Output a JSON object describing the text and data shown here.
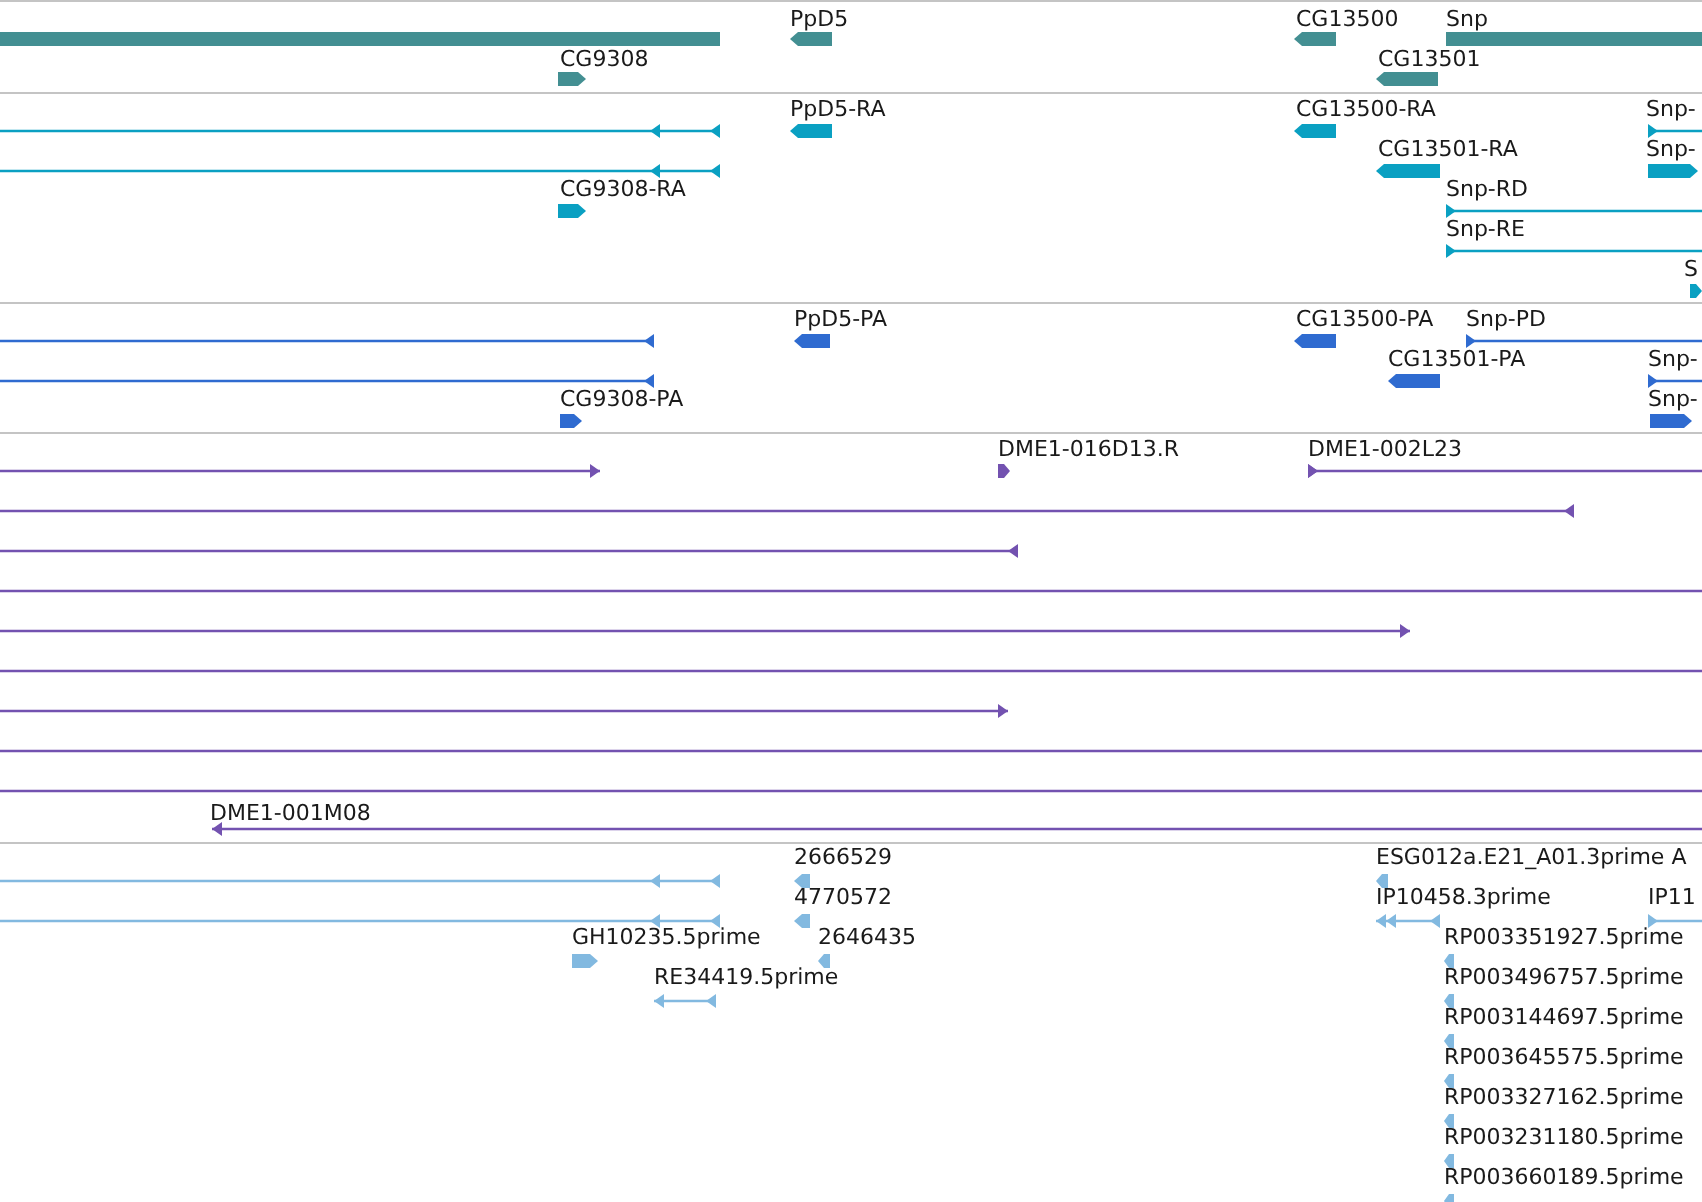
{
  "tracks": [
    {
      "features": [
        {
          "kind": "plain"
        },
        {
          "label": "PpD5",
          "kind": "reverse"
        },
        {
          "label": "CG13500",
          "kind": "reverse"
        },
        {
          "label": "Snp",
          "kind": "plain"
        },
        {
          "label": "CG9308",
          "kind": "forward"
        },
        {
          "label": "CG13501",
          "kind": "reverse"
        }
      ]
    },
    {
      "features": [
        {
          "kind": "reverse"
        },
        {
          "label": "PpD5-RA",
          "kind": "reverse"
        },
        {
          "label": "CG13500-RA",
          "kind": "reverse"
        },
        {
          "label": "Snp-",
          "kind": "forward"
        },
        {
          "kind": "reverse"
        },
        {
          "label": "CG13501-RA",
          "kind": "reverse"
        },
        {
          "label": "Snp-",
          "kind": "forward"
        },
        {
          "label": "CG9308-RA",
          "kind": "forward"
        },
        {
          "label": "Snp-RD",
          "kind": "forward"
        },
        {
          "label": "Snp-RE",
          "kind": "forward"
        },
        {
          "label": "S",
          "kind": "forward"
        }
      ]
    },
    {
      "features": [
        {
          "kind": "reverse"
        },
        {
          "label": "PpD5-PA",
          "kind": "reverse"
        },
        {
          "label": "CG13500-PA",
          "kind": "reverse"
        },
        {
          "label": "Snp-PD",
          "kind": "forward"
        },
        {
          "kind": "reverse"
        },
        {
          "label": "CG13501-PA",
          "kind": "reverse"
        },
        {
          "label": "Snp-",
          "kind": "forward"
        },
        {
          "label": "CG9308-PA",
          "kind": "forward"
        },
        {
          "label": "Snp-",
          "kind": "forward"
        }
      ]
    },
    {
      "features": [
        {
          "kind": "forward"
        },
        {
          "label": "DME1-016D13.R",
          "kind": "forward"
        },
        {
          "label": "DME1-002L23",
          "kind": "forward"
        },
        {
          "kind": "reverse"
        },
        {
          "kind": "reverse"
        },
        {
          "kind": "plain"
        },
        {
          "kind": "forward"
        },
        {
          "kind": "plain"
        },
        {
          "kind": "forward"
        },
        {
          "kind": "plain"
        },
        {
          "kind": "plain"
        },
        {
          "label": "DME1-001M08",
          "kind": "reverse"
        }
      ]
    },
    {
      "features": [
        {
          "kind": "reverse"
        },
        {
          "label": "2666529",
          "kind": "reverse"
        },
        {
          "label": "ESG012a.E21_A01.3prime A",
          "kind": "reverse"
        },
        {
          "kind": "reverse"
        },
        {
          "label": "4770572",
          "kind": "reverse"
        },
        {
          "label": "IP10458.3prime",
          "kind": "reverse"
        },
        {
          "label": "IP11",
          "kind": "forward"
        },
        {
          "label": "GH10235.5prime",
          "kind": "forward"
        },
        {
          "label": "2646435",
          "kind": "reverse"
        },
        {
          "label": "RP003351927.5prime",
          "kind": "reverse"
        },
        {
          "label": "RE34419.5prime",
          "kind": "reverse"
        },
        {
          "label": "RP003496757.5prime",
          "kind": "reverse"
        },
        {
          "label": "RP003144697.5prime",
          "kind": "reverse"
        },
        {
          "label": "RP003645575.5prime",
          "kind": "reverse"
        },
        {
          "label": "RP003327162.5prime",
          "kind": "reverse"
        },
        {
          "label": "RP003231180.5prime",
          "kind": "reverse"
        },
        {
          "label": "RP003660189.5prime",
          "kind": "reverse"
        }
      ]
    }
  ]
}
